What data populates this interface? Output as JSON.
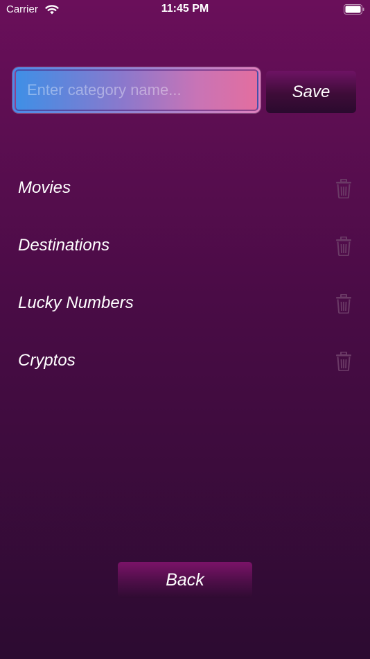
{
  "status_bar": {
    "carrier": "Carrier",
    "time": "11:45 PM",
    "wifi_icon": "wifi-icon",
    "battery_icon": "battery-icon"
  },
  "new_category": {
    "value": "",
    "placeholder": "Enter category name...",
    "save_label": "Save"
  },
  "categories": [
    {
      "label": "Movies",
      "delete_icon": "trash-icon"
    },
    {
      "label": "Destinations",
      "delete_icon": "trash-icon"
    },
    {
      "label": "Lucky Numbers",
      "delete_icon": "trash-icon"
    },
    {
      "label": "Cryptos",
      "delete_icon": "trash-icon"
    }
  ],
  "footer": {
    "back_label": "Back"
  },
  "colors": {
    "background_top": "#6a0f5a",
    "background_bottom": "#2c0b31",
    "input_gradient_start": "#3f8fe6",
    "input_gradient_end": "#e36e9f",
    "trash_icon": "#6b3a66"
  }
}
